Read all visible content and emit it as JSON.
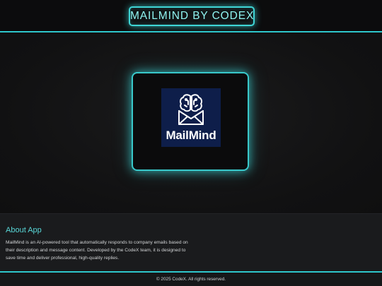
{
  "header": {
    "title": "MAILMIND BY CODEX"
  },
  "hero": {
    "logo_text": "MailMind",
    "logo_icon": "brain-envelope-icon"
  },
  "about": {
    "title": "About App",
    "body": "MailMind is an AI-powered tool that automatically responds to company emails based on their description and message content. Developed by the CodeX team, it is designed to save time and deliver professional, high-quality replies."
  },
  "footer": {
    "text": "© 2025 CodeX. All rights reserved."
  },
  "colors": {
    "accent": "#2ec7cc",
    "title_text": "#8ff4f1",
    "logo_background": "#0e1e4a",
    "page_background": "#111112"
  }
}
